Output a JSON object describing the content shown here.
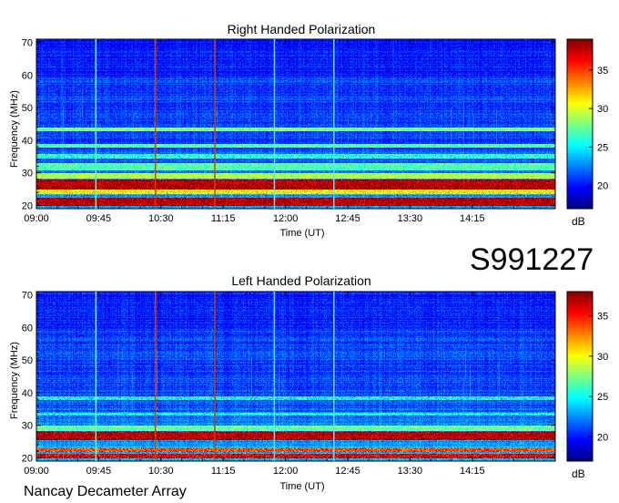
{
  "header": {
    "event_id": "S991227"
  },
  "footer": {
    "text": "Nancay Decameter Array"
  },
  "chart_data": [
    {
      "type": "heatmap",
      "title": "Right Handed Polarization",
      "xlabel": "Time (UT)",
      "ylabel": "Frequency (MHz)",
      "xticks": [
        "09:00",
        "09:45",
        "10:30",
        "11:15",
        "12:00",
        "12:45",
        "13:30",
        "14:15"
      ],
      "xtick_minutes": [
        0,
        45,
        90,
        135,
        180,
        225,
        270,
        315
      ],
      "x_range_minutes": [
        0,
        375
      ],
      "yticks": [
        20,
        30,
        40,
        50,
        60,
        70
      ],
      "ylim": [
        19,
        71
      ],
      "colorbar": {
        "label": "dB",
        "ticks": [
          20,
          25,
          30,
          35
        ],
        "range": [
          17,
          39
        ]
      },
      "bright_bands_mhz": [
        {
          "freq": [
            20,
            22.5
          ],
          "level": 38
        },
        {
          "freq": [
            23.5,
            25
          ],
          "level": 31
        },
        {
          "freq": [
            25,
            28
          ],
          "level": 38
        },
        {
          "freq": [
            28.5,
            30
          ],
          "level": 29
        },
        {
          "freq": [
            31,
            33
          ],
          "level": 27
        },
        {
          "freq": [
            34.5,
            36
          ],
          "level": 26
        },
        {
          "freq": [
            38,
            39
          ],
          "level": 27
        },
        {
          "freq": [
            43,
            44
          ],
          "level": 28
        }
      ],
      "vertical_lines": [
        {
          "time_minutes": 43,
          "color": "#7ff0c8"
        },
        {
          "time_minutes": 86,
          "color": "#d04000"
        },
        {
          "time_minutes": 129,
          "color": "#d04000"
        },
        {
          "time_minutes": 172,
          "color": "#66e0ff"
        },
        {
          "time_minutes": 215,
          "color": "#66e0ff"
        }
      ],
      "background_level": 21
    },
    {
      "type": "heatmap",
      "title": "Left Handed Polarization",
      "xlabel": "Time (UT)",
      "ylabel": "Frequency (MHz)",
      "xticks": [
        "09:00",
        "09:45",
        "10:30",
        "11:15",
        "12:00",
        "12:45",
        "13:30",
        "14:15"
      ],
      "xtick_minutes": [
        0,
        45,
        90,
        135,
        180,
        225,
        270,
        315
      ],
      "x_range_minutes": [
        0,
        375
      ],
      "yticks": [
        20,
        30,
        40,
        50,
        60,
        70
      ],
      "ylim": [
        19,
        71
      ],
      "colorbar": {
        "label": "dB",
        "ticks": [
          20,
          25,
          30,
          35
        ],
        "range": [
          17,
          38
        ]
      },
      "bright_bands_mhz": [
        {
          "freq": [
            20,
            21.5
          ],
          "level": 36
        },
        {
          "freq": [
            22,
            23
          ],
          "level": 34
        },
        {
          "freq": [
            25.5,
            28
          ],
          "level": 37
        },
        {
          "freq": [
            28.5,
            30
          ],
          "level": 27
        },
        {
          "freq": [
            33,
            34
          ],
          "level": 25
        },
        {
          "freq": [
            38,
            39
          ],
          "level": 25
        }
      ],
      "vertical_lines": [
        {
          "time_minutes": 43,
          "color": "#7ff0c8"
        },
        {
          "time_minutes": 86,
          "color": "#d04000"
        },
        {
          "time_minutes": 129,
          "color": "#d04000"
        },
        {
          "time_minutes": 172,
          "color": "#66e0ff"
        },
        {
          "time_minutes": 215,
          "color": "#66e0ff"
        }
      ],
      "background_level": 21
    }
  ]
}
